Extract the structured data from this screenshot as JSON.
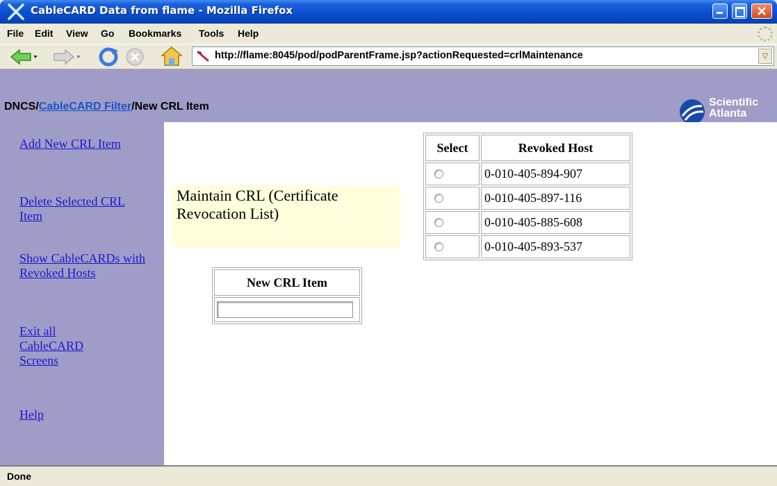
{
  "window": {
    "title": "CableCARD Data from flame - Mozilla Firefox"
  },
  "menu": [
    "File",
    "Edit",
    "View",
    "Go",
    "Bookmarks",
    "Tools",
    "Help"
  ],
  "toolbar": {
    "url": "http://flame:8045/pod/podParentFrame.jsp?actionRequested=crlMaintenance",
    "icons": [
      "back-icon",
      "forward-icon",
      "reload-icon",
      "stop-icon",
      "home-icon"
    ]
  },
  "breadcrumb": {
    "root": "DNCS/",
    "link": "CableCARD Filter",
    "current": "/New CRL Item"
  },
  "logo": {
    "line1": "Scientific",
    "line2": "Atlanta"
  },
  "sidebar": [
    {
      "label": "Add New CRL Item"
    },
    {
      "label": "Delete Selected CRL Item"
    },
    {
      "label": "Show CableCARDs with Revoked Hosts"
    },
    {
      "label": "Exit all CableCARD Screens"
    },
    {
      "label": "Help"
    }
  ],
  "main": {
    "heading": "Maintain CRL (Certificate Revocation List)",
    "new_item_header": "New CRL Item",
    "new_item_value": "",
    "table": {
      "headers": [
        "Select",
        "Revoked Host"
      ],
      "rows": [
        "0-010-405-894-907",
        "0-010-405-897-116",
        "0-010-405-885-608",
        "0-010-405-893-537"
      ]
    }
  },
  "status": "Done"
}
